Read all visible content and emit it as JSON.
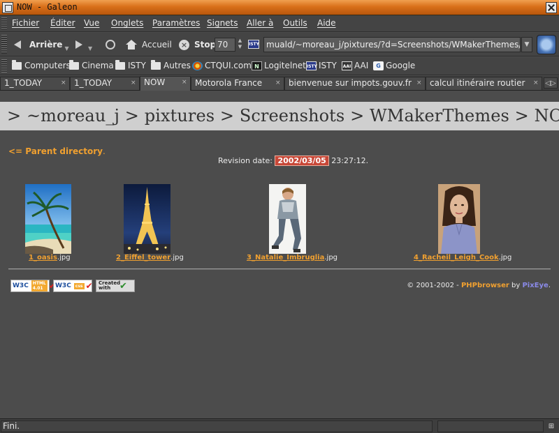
{
  "window": {
    "title": "NOW - Galeon"
  },
  "menubar": {
    "items": [
      "Fichier",
      "Éditer",
      "Vue",
      "Onglets",
      "Paramètres",
      "Signets",
      "Aller à",
      "Outils",
      "Aide"
    ]
  },
  "navbar": {
    "back_label": "Arrière",
    "home_label": "Accueil",
    "stop_label": "Stop",
    "zoom_value": "70",
    "url_value": "muald/~moreau_j/pixtures/?d=Screenshots/WMakerThemes/NOW"
  },
  "bookmarks": {
    "items": [
      {
        "label": "Computers",
        "icon": "folder-icon"
      },
      {
        "label": "Cinema",
        "icon": "folder-icon"
      },
      {
        "label": "ISTY",
        "icon": "folder-icon"
      },
      {
        "label": "Autres",
        "icon": "folder-icon"
      },
      {
        "label": "CTQUI.com",
        "icon": "ctqui-icon"
      },
      {
        "label": "Logitelnet",
        "icon": "logitelnet-icon"
      },
      {
        "label": "ISTY",
        "icon": "isty-icon"
      },
      {
        "label": "AAI",
        "icon": "aai-icon"
      },
      {
        "label": "Google",
        "icon": "google-icon"
      }
    ],
    "icon_text": {
      "logi": "N",
      "isty": "ISTY",
      "aai": "AAI",
      "goog": "G"
    }
  },
  "tabs": {
    "items": [
      {
        "label": "1_TODAY"
      },
      {
        "label": "1_TODAY"
      },
      {
        "label": "NOW"
      },
      {
        "label": "Motorola France"
      },
      {
        "label": "bienvenue sur impots.gouv.fr"
      },
      {
        "label": "calcul itinéraire routier"
      }
    ],
    "active_index": 2
  },
  "page": {
    "path_banner": "> ~moreau_j > pixtures > Screenshots > WMakerThemes > NOW",
    "parent_link": "<= Parent directory",
    "parent_suffix": ".",
    "revision_label": "Revision date:",
    "revision_date": "2002/03/05",
    "revision_time": "23:27:12.",
    "thumbnails": [
      {
        "name": "1_oasis",
        "ext": ".jpg"
      },
      {
        "name": "2_Eiffel_tower",
        "ext": ".jpg"
      },
      {
        "name": "3_Natalie_Imbruglia",
        "ext": ".jpg"
      },
      {
        "name": "4_Racheil_Leigh_Cook",
        "ext": ".jpg"
      }
    ],
    "badges": {
      "html_w3": "W3C",
      "html_tag": "HTML 4.01",
      "css_w3": "W3C",
      "css_tag": "css",
      "vim_text": "Created with"
    },
    "copyright_prefix": "© 2001-2002 - ",
    "copyright_php": "PHPbrowser",
    "copyright_by": " by ",
    "copyright_pix": "PixEye",
    "copyright_end": "."
  },
  "status": {
    "text": "Fini."
  }
}
